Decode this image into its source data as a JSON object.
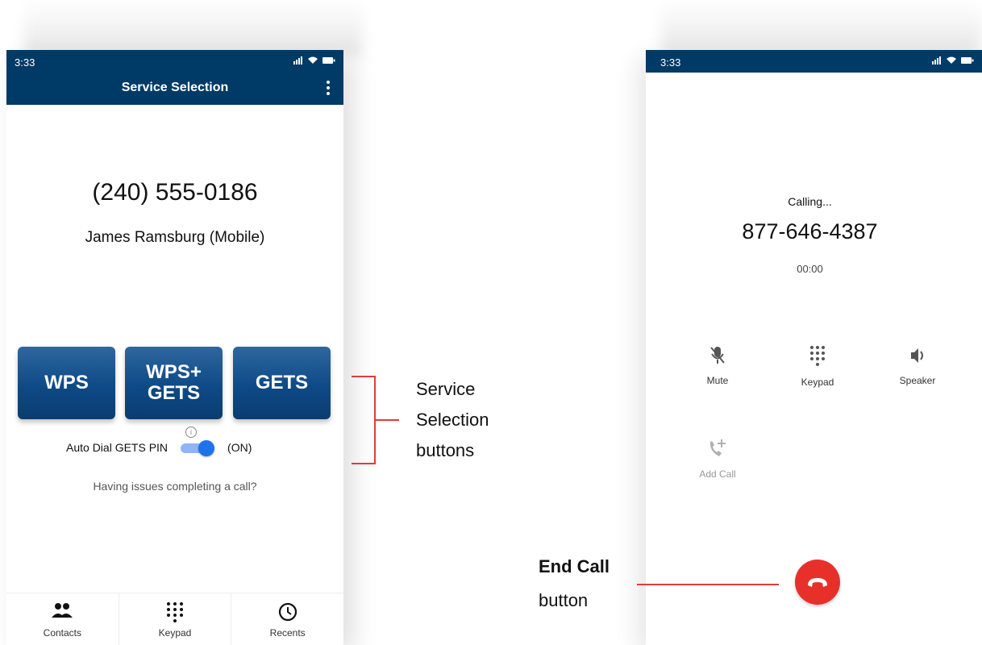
{
  "colors": {
    "header_bg": "#003a66",
    "service_button": "#0e4a86",
    "toggle_on": "#1f73e8",
    "end_call": "#e8302a",
    "annotation": "#e53a3a"
  },
  "left_screen": {
    "status_time": "3:33",
    "app_title": "Service Selection",
    "menu_icon": "kebab-menu-icon",
    "phone_number": "(240) 555-0186",
    "contact_name": "James Ramsburg (Mobile)",
    "buttons": {
      "wps": "WPS",
      "wps_gets_line1": "WPS+",
      "wps_gets_line2": "GETS",
      "gets": "GETS"
    },
    "auto_dial_label": "Auto Dial GETS PIN",
    "auto_dial_state": "(ON)",
    "info_icon_text": "i",
    "issues_link": "Having issues completing a call?",
    "nav": [
      {
        "label": "Contacts",
        "icon": "contacts-icon"
      },
      {
        "label": "Keypad",
        "icon": "keypad-icon"
      },
      {
        "label": "Recents",
        "icon": "clock-icon"
      }
    ]
  },
  "right_screen": {
    "status_time": "3:33",
    "calling_label": "Calling...",
    "dialed_number": "877-646-4387",
    "timer": "00:00",
    "controls": {
      "mute": "Mute",
      "keypad": "Keypad",
      "speaker": "Speaker",
      "add_call": "Add Call"
    }
  },
  "annotations": {
    "service_line1": "Service",
    "service_line2": "Selection",
    "service_line3": "buttons",
    "end_call_bold": "End Call",
    "end_call_line2": "button"
  }
}
